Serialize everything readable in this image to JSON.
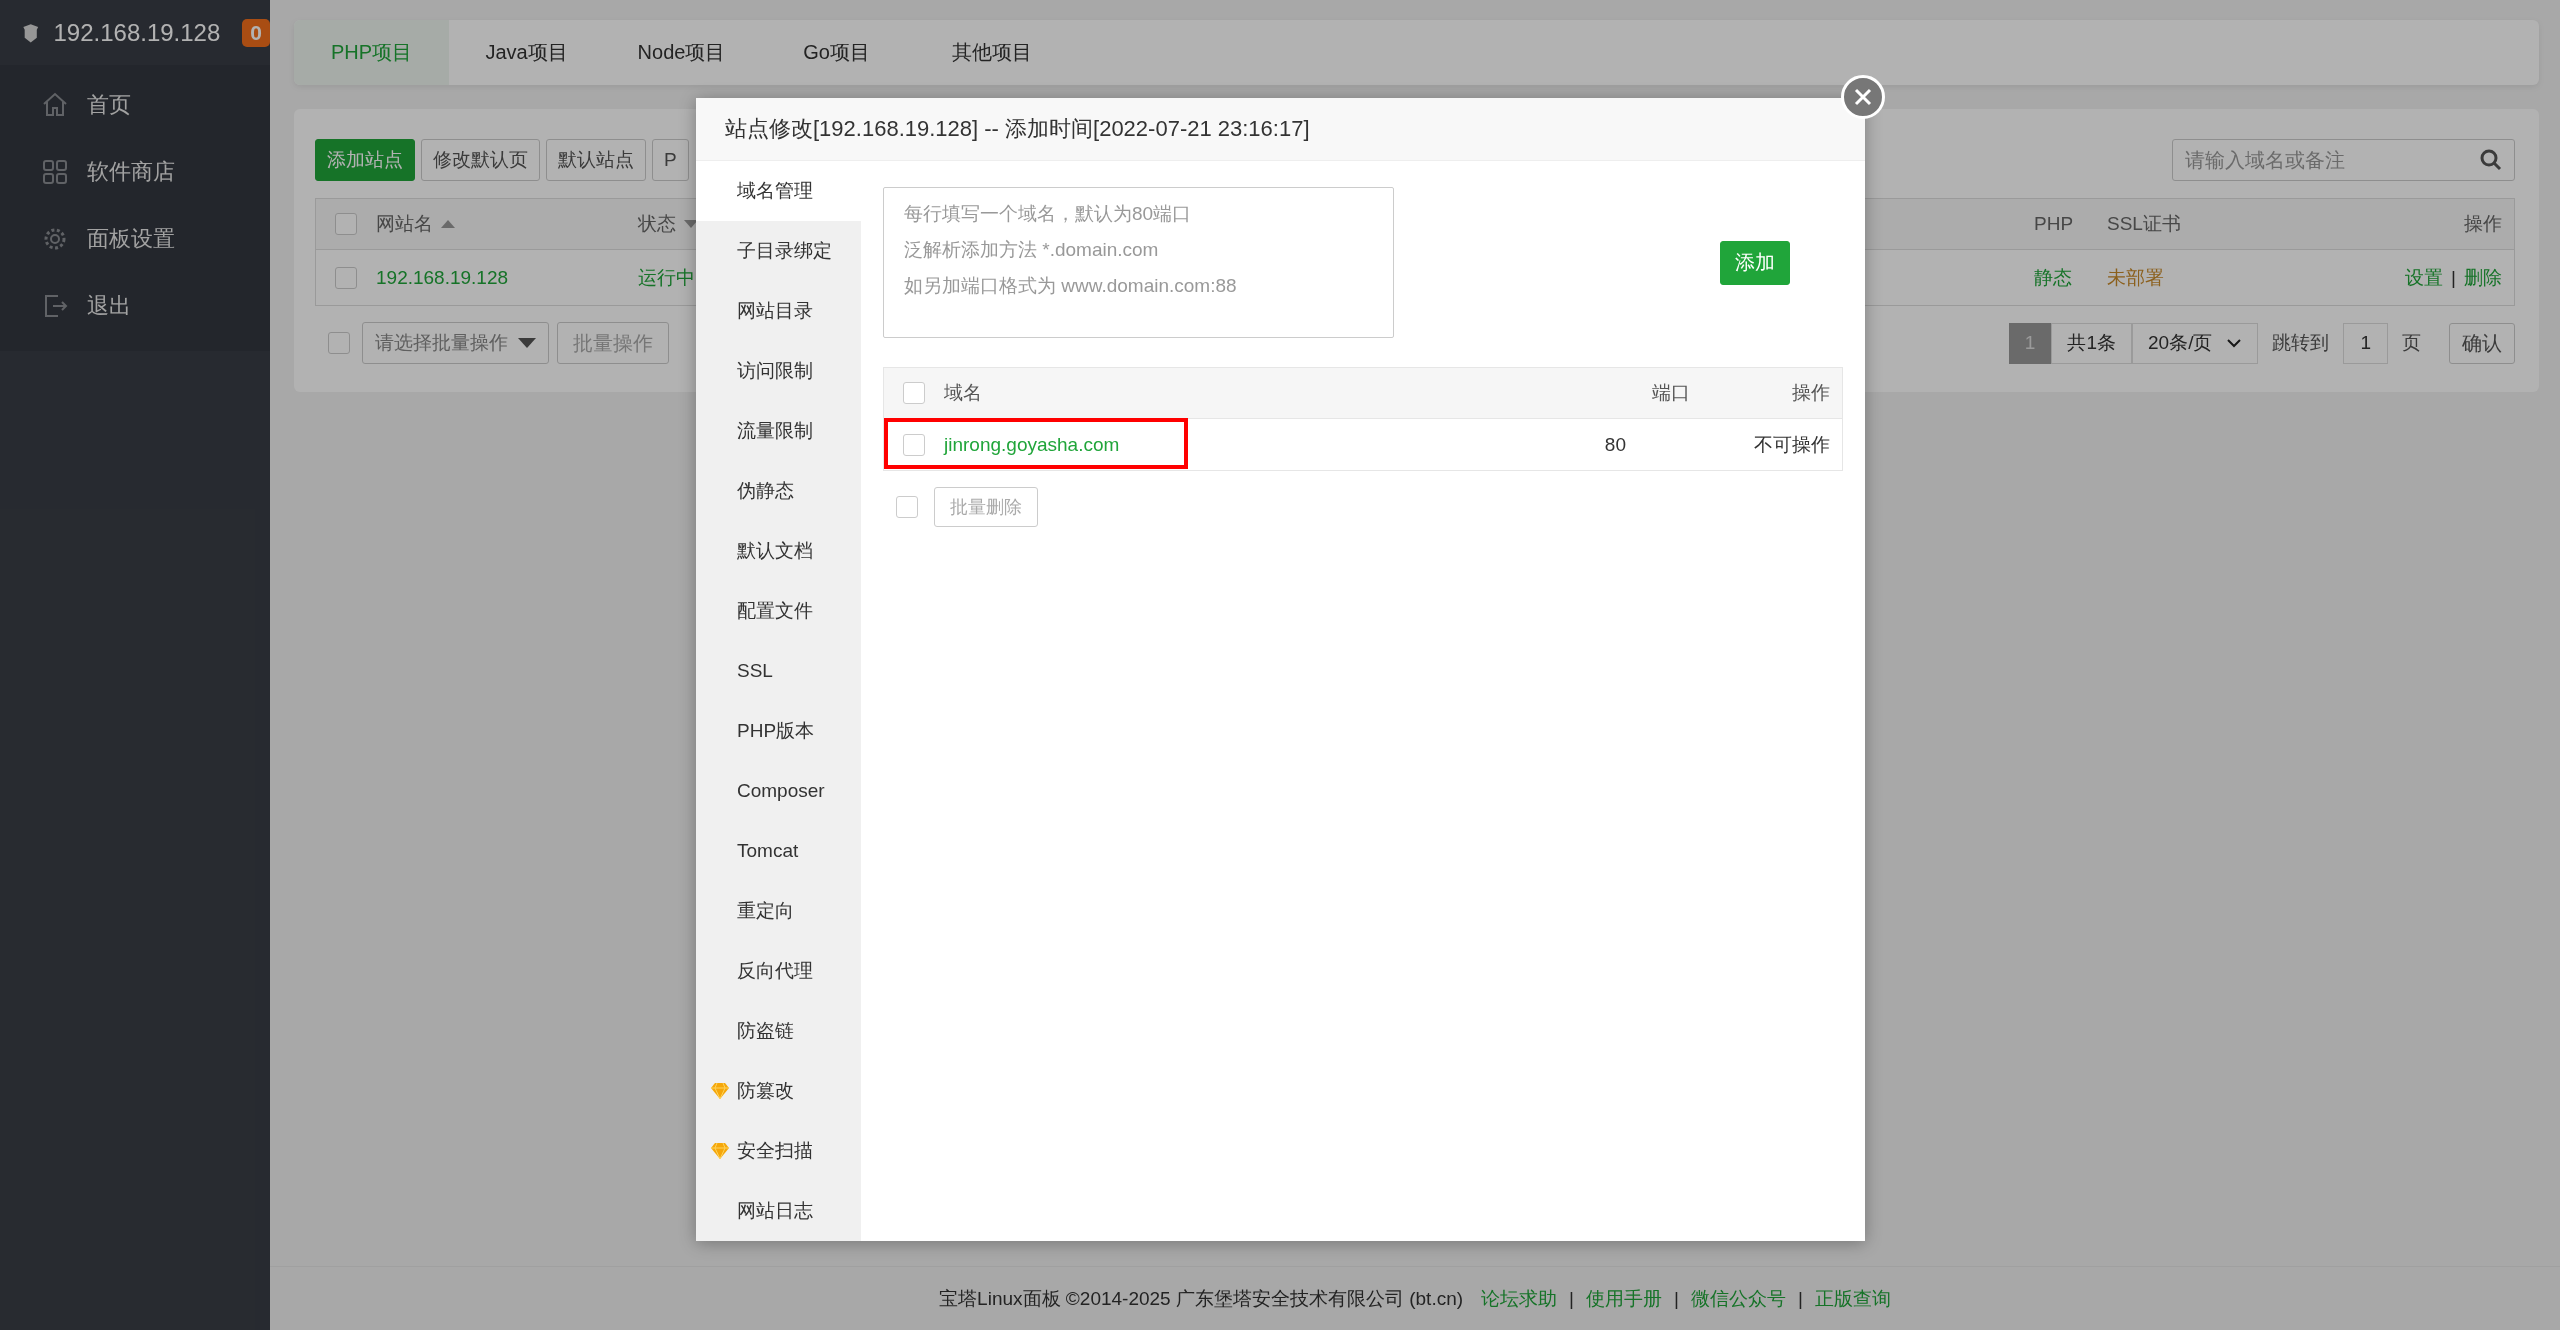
{
  "sidebar": {
    "title": "192.168.19.128",
    "badge": "0",
    "items": [
      {
        "label": "首页",
        "kind": "home"
      },
      {
        "label": "软件商店",
        "kind": "apps"
      },
      {
        "label": "面板设置",
        "kind": "settings"
      },
      {
        "label": "退出",
        "kind": "logout"
      }
    ]
  },
  "tabs": [
    {
      "label": "PHP项目",
      "selected": true
    },
    {
      "label": "Java项目",
      "selected": false
    },
    {
      "label": "Node项目",
      "selected": false
    },
    {
      "label": "Go项目",
      "selected": false
    },
    {
      "label": "其他项目",
      "selected": false
    }
  ],
  "toolbar": {
    "buttons": [
      {
        "label": "添加站点",
        "primary": true
      },
      {
        "label": "修改默认页",
        "primary": false
      },
      {
        "label": "默认站点",
        "primary": false
      },
      {
        "label": "P",
        "primary": false
      }
    ],
    "search": {
      "placeholder": "请输入域名或备注"
    }
  },
  "table": {
    "header_checked": false,
    "columns": [
      {
        "label": "网站名",
        "sorted": true,
        "ascending": true
      },
      {
        "label": "状态",
        "sorted": true,
        "ascending": false
      },
      {
        "label": "PHP"
      },
      {
        "label": "SSL证书"
      },
      {
        "label": "操作"
      }
    ],
    "rows": [
      {
        "checked": false,
        "name": "192.168.19.128",
        "status": "运行中",
        "php": "静态",
        "ssl": "未部署",
        "actions": [
          "设置",
          "删除"
        ],
        "separator": "|"
      }
    ]
  },
  "batch": {
    "checked": false,
    "select": "请选择批量操作",
    "button": "批量操作",
    "disabled": true
  },
  "pagination": {
    "pages": [
      {
        "label": "1",
        "selected": true
      }
    ],
    "total": "共1条",
    "page_size": "20条/页",
    "jump_label": "跳转到",
    "jump_value": "1",
    "page_unit": "页",
    "confirm": "确认"
  },
  "modal": {
    "title": "站点修改[192.168.19.128] -- 添加时间[2022-07-21 23:16:17]",
    "menu": [
      {
        "label": "域名管理",
        "selected": true,
        "premium": false
      },
      {
        "label": "子目录绑定",
        "selected": false,
        "premium": false
      },
      {
        "label": "网站目录",
        "selected": false,
        "premium": false
      },
      {
        "label": "访问限制",
        "selected": false,
        "premium": false
      },
      {
        "label": "流量限制",
        "selected": false,
        "premium": false
      },
      {
        "label": "伪静态",
        "selected": false,
        "premium": false
      },
      {
        "label": "默认文档",
        "selected": false,
        "premium": false
      },
      {
        "label": "配置文件",
        "selected": false,
        "premium": false
      },
      {
        "label": "SSL",
        "selected": false,
        "premium": false
      },
      {
        "label": "PHP版本",
        "selected": false,
        "premium": false
      },
      {
        "label": "Composer",
        "selected": false,
        "premium": false
      },
      {
        "label": "Tomcat",
        "selected": false,
        "premium": false
      },
      {
        "label": "重定向",
        "selected": false,
        "premium": false
      },
      {
        "label": "反向代理",
        "selected": false,
        "premium": false
      },
      {
        "label": "防盗链",
        "selected": false,
        "premium": false
      },
      {
        "label": "防篡改",
        "selected": false,
        "premium": true
      },
      {
        "label": "安全扫描",
        "selected": false,
        "premium": true
      },
      {
        "label": "网站日志",
        "selected": false,
        "premium": false
      }
    ],
    "domain_input": {
      "placeholder": [
        "每行填写一个域名，默认为80端口",
        "泛解析添加方法 *.domain.com",
        "如另加端口格式为 www.domain.com:88"
      ]
    },
    "add_button": "添加",
    "domains": {
      "header_checked": false,
      "columns": [
        "域名",
        "端口",
        "操作"
      ],
      "rows": [
        {
          "checked": false,
          "domain": "jinrong.goyasha.com",
          "port": "80",
          "action": "不可操作",
          "highlighted": true
        }
      ]
    },
    "batch_checked": false,
    "batch_button": "批量删除",
    "batch_disabled": true
  },
  "footer": {
    "text": "宝塔Linux面板 ©2014-2025 广东堡塔安全技术有限公司 (bt.cn)",
    "links": [
      "论坛求助",
      "使用手册",
      "微信公众号",
      "正版查询"
    ],
    "separator": "|"
  }
}
